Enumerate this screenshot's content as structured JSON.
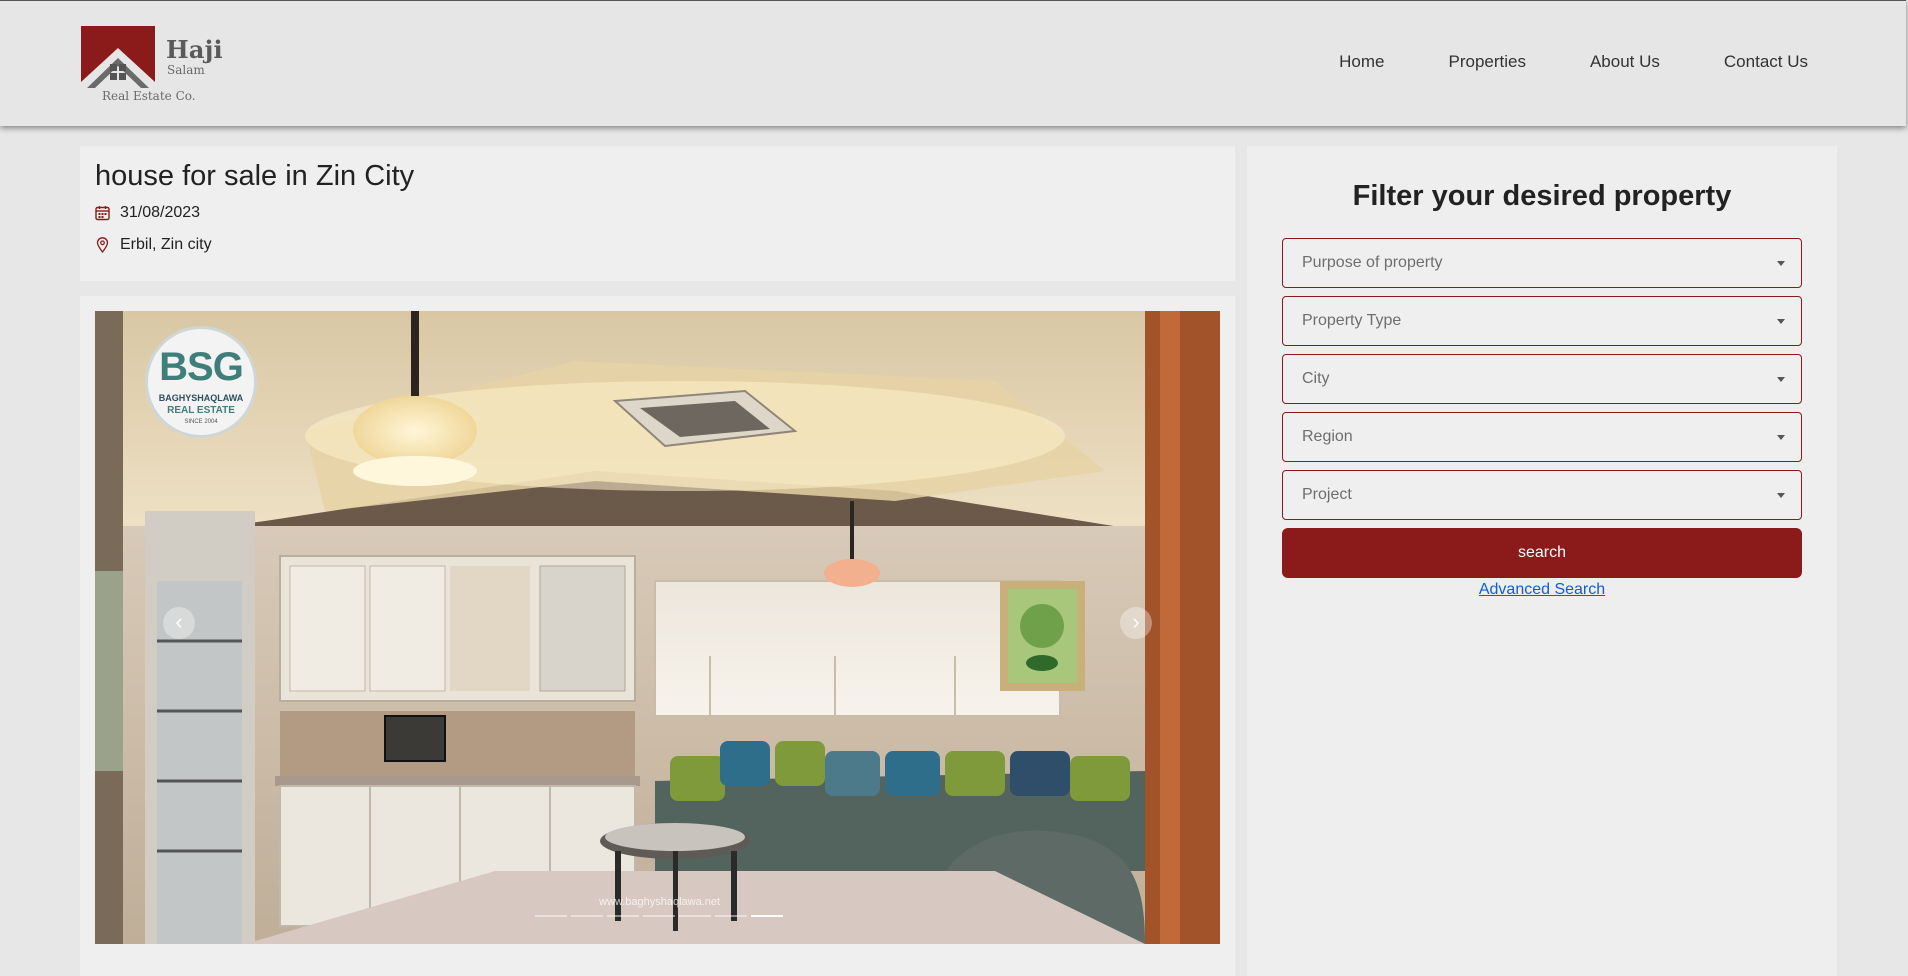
{
  "brand": {
    "name_line1": "Haji",
    "name_line2": "Salam",
    "tagline": "Real Estate Co.",
    "color": "#8b1a1a"
  },
  "nav": {
    "items": [
      {
        "label": "Home"
      },
      {
        "label": "Properties"
      },
      {
        "label": "About Us"
      },
      {
        "label": "Contact Us"
      }
    ]
  },
  "listing": {
    "title": "house for sale in Zin City",
    "date": "31/08/2023",
    "date_icon": "calendar-icon",
    "location": "Erbil, Zin city",
    "location_icon": "map-pin-icon"
  },
  "gallery": {
    "watermark": {
      "logo_text": "BSG",
      "name": "BAGHYSHAQLAWA",
      "sub": "REAL ESTATE",
      "since": "SINCE 2004"
    },
    "watermark_site": "www.baghyshaqlawa.net",
    "slide_count": 7,
    "active_slide": 7,
    "prev_icon": "chevron-left-icon",
    "next_icon": "chevron-right-icon"
  },
  "filter": {
    "title": "Filter your desired property",
    "fields": [
      {
        "placeholder": "Purpose of property"
      },
      {
        "placeholder": "Property Type"
      },
      {
        "placeholder": "City"
      },
      {
        "placeholder": "Region"
      },
      {
        "placeholder": "Project"
      }
    ],
    "search_label": "search",
    "advanced_label": "Advanced Search",
    "accent": "#8b1a1a",
    "link_color": "#0b5ed7"
  }
}
